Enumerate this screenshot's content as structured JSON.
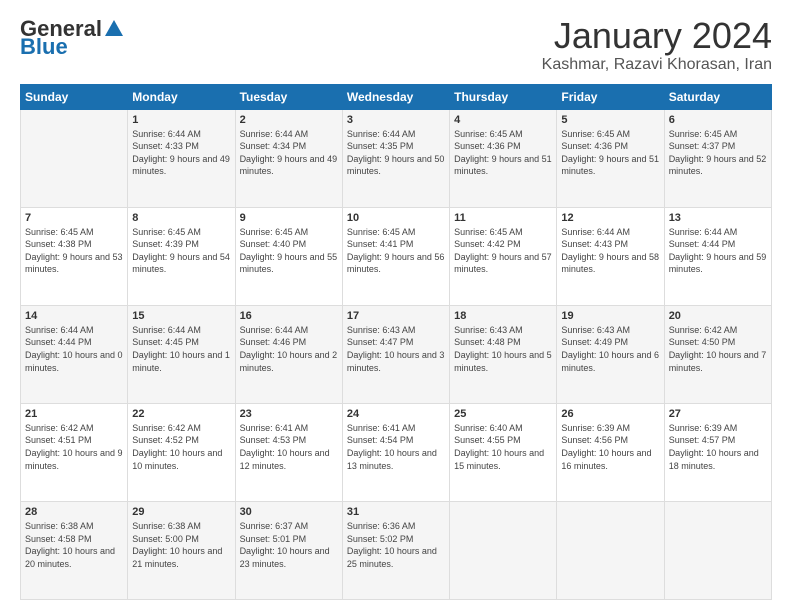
{
  "header": {
    "logo_general": "General",
    "logo_blue": "Blue",
    "title": "January 2024",
    "subtitle": "Kashmar, Razavi Khorasan, Iran"
  },
  "days_of_week": [
    "Sunday",
    "Monday",
    "Tuesday",
    "Wednesday",
    "Thursday",
    "Friday",
    "Saturday"
  ],
  "weeks": [
    [
      {
        "day": "",
        "sunrise": "",
        "sunset": "",
        "daylight": ""
      },
      {
        "day": "1",
        "sunrise": "Sunrise: 6:44 AM",
        "sunset": "Sunset: 4:33 PM",
        "daylight": "Daylight: 9 hours and 49 minutes."
      },
      {
        "day": "2",
        "sunrise": "Sunrise: 6:44 AM",
        "sunset": "Sunset: 4:34 PM",
        "daylight": "Daylight: 9 hours and 49 minutes."
      },
      {
        "day": "3",
        "sunrise": "Sunrise: 6:44 AM",
        "sunset": "Sunset: 4:35 PM",
        "daylight": "Daylight: 9 hours and 50 minutes."
      },
      {
        "day": "4",
        "sunrise": "Sunrise: 6:45 AM",
        "sunset": "Sunset: 4:36 PM",
        "daylight": "Daylight: 9 hours and 51 minutes."
      },
      {
        "day": "5",
        "sunrise": "Sunrise: 6:45 AM",
        "sunset": "Sunset: 4:36 PM",
        "daylight": "Daylight: 9 hours and 51 minutes."
      },
      {
        "day": "6",
        "sunrise": "Sunrise: 6:45 AM",
        "sunset": "Sunset: 4:37 PM",
        "daylight": "Daylight: 9 hours and 52 minutes."
      }
    ],
    [
      {
        "day": "7",
        "sunrise": "Sunrise: 6:45 AM",
        "sunset": "Sunset: 4:38 PM",
        "daylight": "Daylight: 9 hours and 53 minutes."
      },
      {
        "day": "8",
        "sunrise": "Sunrise: 6:45 AM",
        "sunset": "Sunset: 4:39 PM",
        "daylight": "Daylight: 9 hours and 54 minutes."
      },
      {
        "day": "9",
        "sunrise": "Sunrise: 6:45 AM",
        "sunset": "Sunset: 4:40 PM",
        "daylight": "Daylight: 9 hours and 55 minutes."
      },
      {
        "day": "10",
        "sunrise": "Sunrise: 6:45 AM",
        "sunset": "Sunset: 4:41 PM",
        "daylight": "Daylight: 9 hours and 56 minutes."
      },
      {
        "day": "11",
        "sunrise": "Sunrise: 6:45 AM",
        "sunset": "Sunset: 4:42 PM",
        "daylight": "Daylight: 9 hours and 57 minutes."
      },
      {
        "day": "12",
        "sunrise": "Sunrise: 6:44 AM",
        "sunset": "Sunset: 4:43 PM",
        "daylight": "Daylight: 9 hours and 58 minutes."
      },
      {
        "day": "13",
        "sunrise": "Sunrise: 6:44 AM",
        "sunset": "Sunset: 4:44 PM",
        "daylight": "Daylight: 9 hours and 59 minutes."
      }
    ],
    [
      {
        "day": "14",
        "sunrise": "Sunrise: 6:44 AM",
        "sunset": "Sunset: 4:44 PM",
        "daylight": "Daylight: 10 hours and 0 minutes."
      },
      {
        "day": "15",
        "sunrise": "Sunrise: 6:44 AM",
        "sunset": "Sunset: 4:45 PM",
        "daylight": "Daylight: 10 hours and 1 minute."
      },
      {
        "day": "16",
        "sunrise": "Sunrise: 6:44 AM",
        "sunset": "Sunset: 4:46 PM",
        "daylight": "Daylight: 10 hours and 2 minutes."
      },
      {
        "day": "17",
        "sunrise": "Sunrise: 6:43 AM",
        "sunset": "Sunset: 4:47 PM",
        "daylight": "Daylight: 10 hours and 3 minutes."
      },
      {
        "day": "18",
        "sunrise": "Sunrise: 6:43 AM",
        "sunset": "Sunset: 4:48 PM",
        "daylight": "Daylight: 10 hours and 5 minutes."
      },
      {
        "day": "19",
        "sunrise": "Sunrise: 6:43 AM",
        "sunset": "Sunset: 4:49 PM",
        "daylight": "Daylight: 10 hours and 6 minutes."
      },
      {
        "day": "20",
        "sunrise": "Sunrise: 6:42 AM",
        "sunset": "Sunset: 4:50 PM",
        "daylight": "Daylight: 10 hours and 7 minutes."
      }
    ],
    [
      {
        "day": "21",
        "sunrise": "Sunrise: 6:42 AM",
        "sunset": "Sunset: 4:51 PM",
        "daylight": "Daylight: 10 hours and 9 minutes."
      },
      {
        "day": "22",
        "sunrise": "Sunrise: 6:42 AM",
        "sunset": "Sunset: 4:52 PM",
        "daylight": "Daylight: 10 hours and 10 minutes."
      },
      {
        "day": "23",
        "sunrise": "Sunrise: 6:41 AM",
        "sunset": "Sunset: 4:53 PM",
        "daylight": "Daylight: 10 hours and 12 minutes."
      },
      {
        "day": "24",
        "sunrise": "Sunrise: 6:41 AM",
        "sunset": "Sunset: 4:54 PM",
        "daylight": "Daylight: 10 hours and 13 minutes."
      },
      {
        "day": "25",
        "sunrise": "Sunrise: 6:40 AM",
        "sunset": "Sunset: 4:55 PM",
        "daylight": "Daylight: 10 hours and 15 minutes."
      },
      {
        "day": "26",
        "sunrise": "Sunrise: 6:39 AM",
        "sunset": "Sunset: 4:56 PM",
        "daylight": "Daylight: 10 hours and 16 minutes."
      },
      {
        "day": "27",
        "sunrise": "Sunrise: 6:39 AM",
        "sunset": "Sunset: 4:57 PM",
        "daylight": "Daylight: 10 hours and 18 minutes."
      }
    ],
    [
      {
        "day": "28",
        "sunrise": "Sunrise: 6:38 AM",
        "sunset": "Sunset: 4:58 PM",
        "daylight": "Daylight: 10 hours and 20 minutes."
      },
      {
        "day": "29",
        "sunrise": "Sunrise: 6:38 AM",
        "sunset": "Sunset: 5:00 PM",
        "daylight": "Daylight: 10 hours and 21 minutes."
      },
      {
        "day": "30",
        "sunrise": "Sunrise: 6:37 AM",
        "sunset": "Sunset: 5:01 PM",
        "daylight": "Daylight: 10 hours and 23 minutes."
      },
      {
        "day": "31",
        "sunrise": "Sunrise: 6:36 AM",
        "sunset": "Sunset: 5:02 PM",
        "daylight": "Daylight: 10 hours and 25 minutes."
      },
      {
        "day": "",
        "sunrise": "",
        "sunset": "",
        "daylight": ""
      },
      {
        "day": "",
        "sunrise": "",
        "sunset": "",
        "daylight": ""
      },
      {
        "day": "",
        "sunrise": "",
        "sunset": "",
        "daylight": ""
      }
    ]
  ]
}
